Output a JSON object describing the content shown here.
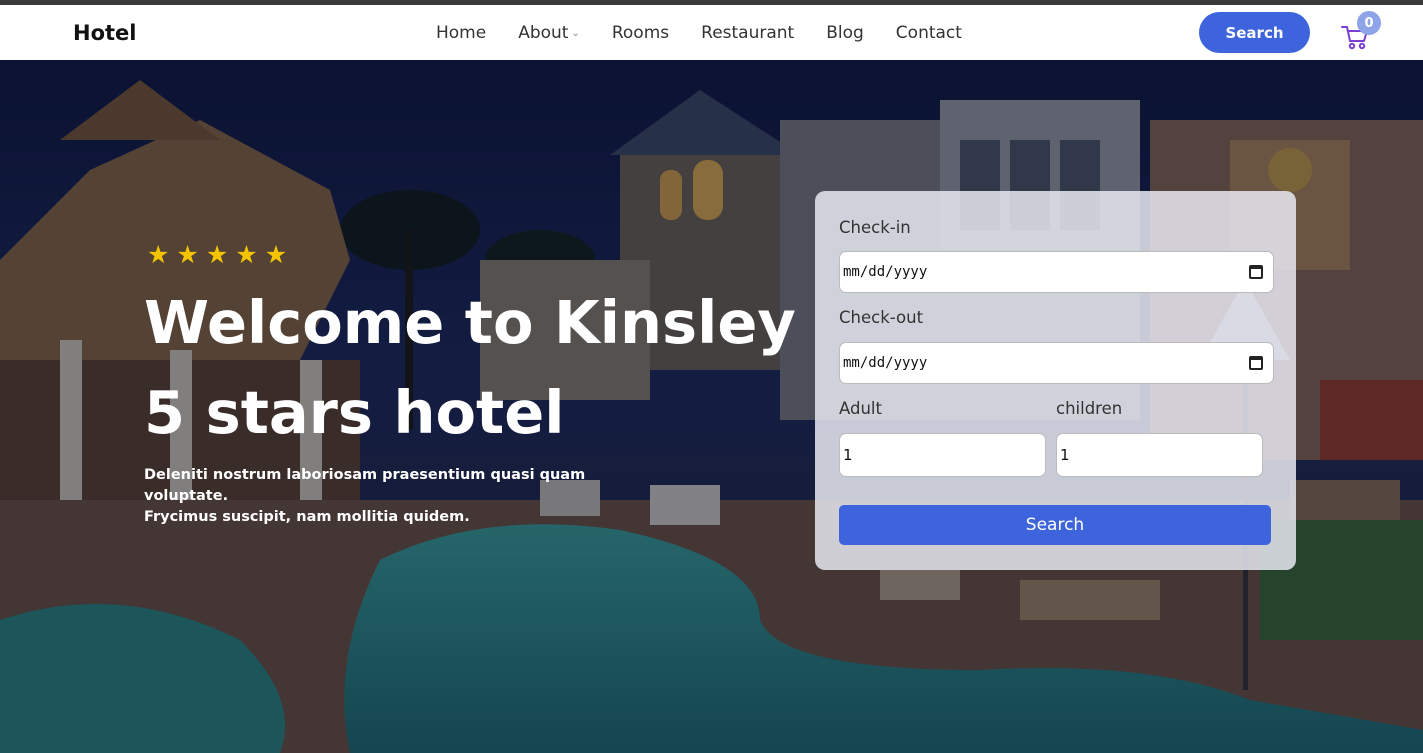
{
  "navbar": {
    "brand": "Hotel",
    "links": [
      {
        "label": "Home"
      },
      {
        "label": "About"
      },
      {
        "label": "Rooms"
      },
      {
        "label": "Restaurant"
      },
      {
        "label": "Blog"
      },
      {
        "label": "Contact"
      }
    ],
    "search_label": "Search",
    "cart_count": "0"
  },
  "hero": {
    "star_count": 5,
    "title_line1": "Welcome to Kinsley",
    "title_line2": "5 stars hotel",
    "subtitle_line1": "Deleniti nostrum laboriosam praesentium quasi quam voluptate.",
    "subtitle_line2": "Frycimus suscipit, nam mollitia quidem."
  },
  "booking": {
    "checkin_label": "Check-in",
    "checkin_placeholder": "mm/dd/yyyy",
    "checkout_label": "Check-out",
    "checkout_placeholder": "mm/dd/yyyy",
    "adult_label": "Adult",
    "adult_value": "1",
    "children_label": "children",
    "children_value": "1",
    "search_label": "Search"
  },
  "colors": {
    "accent": "#3d63dd",
    "star": "#f5c400",
    "badge": "#8ea3e8"
  }
}
